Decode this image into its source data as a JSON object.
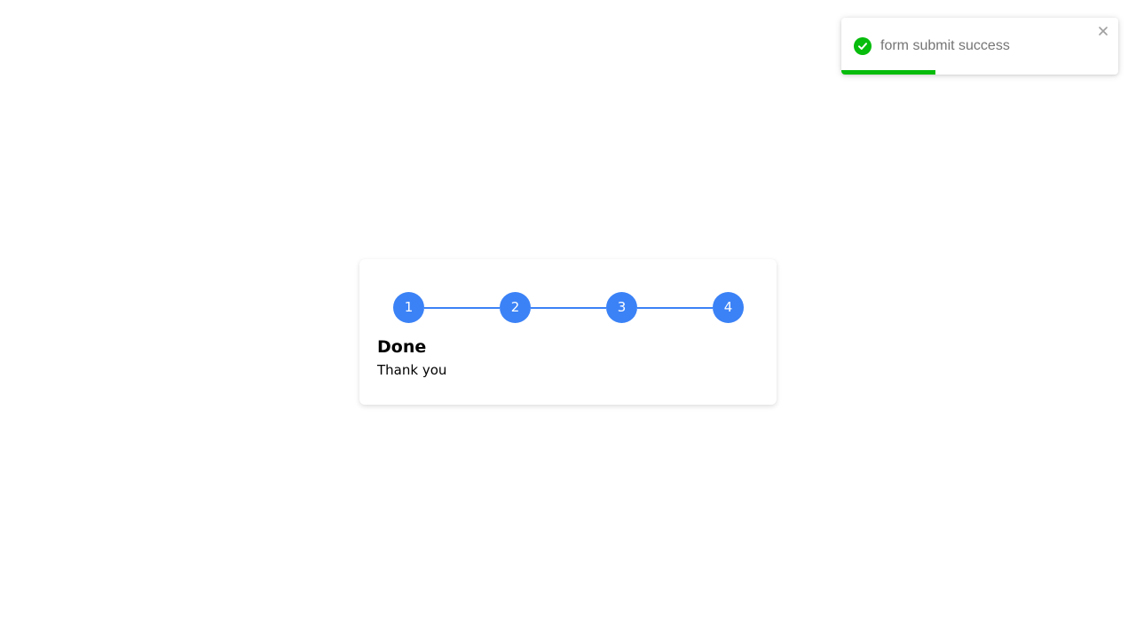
{
  "toast": {
    "message": "form submit success",
    "status": "success",
    "icon": "check-circle-icon",
    "close_icon": "close-icon",
    "accent_color": "#07bc0c",
    "progress_remaining": 0.34
  },
  "stepper": {
    "accent_color": "#3b82f6",
    "steps": [
      {
        "label": "1"
      },
      {
        "label": "2"
      },
      {
        "label": "3"
      },
      {
        "label": "4"
      }
    ]
  },
  "card": {
    "title": "Done",
    "subtitle": "Thank you"
  }
}
